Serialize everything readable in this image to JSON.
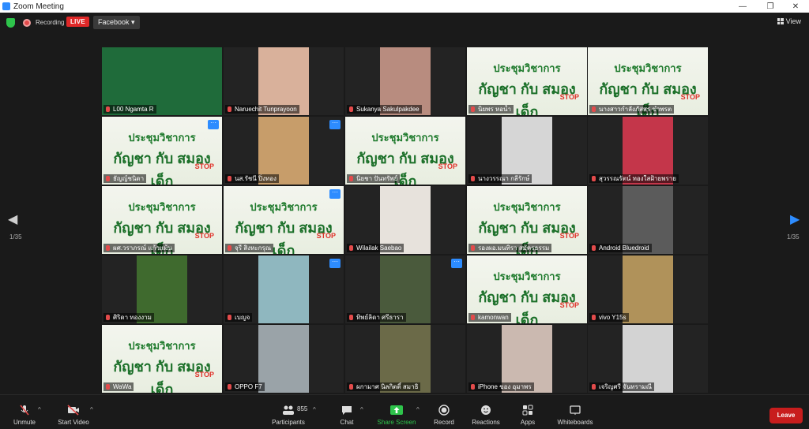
{
  "window": {
    "title": "Zoom Meeting",
    "minimize": "—",
    "maximize": "❐",
    "close": "✕"
  },
  "topbar": {
    "recording_label": "Recording",
    "live_badge": "LIVE",
    "stream_target": "Facebook ▾",
    "view_label": "View"
  },
  "pagination": {
    "left_page": "1/35",
    "right_page": "1/35"
  },
  "poster": {
    "title": "ประชุมวิชาการ",
    "subtitle": "กัญชา กับ สมองเด็ก",
    "stop": "STOP"
  },
  "tiles": [
    {
      "name": "L00 Ngamta R",
      "type": "video",
      "color": "#1f6b3a",
      "active": true
    },
    {
      "name": "Naruechit Tunprayoon",
      "type": "photo",
      "color": "#d9b19b"
    },
    {
      "name": "Sukanya Sakulpakdee",
      "type": "photo",
      "color": "#b88c7f"
    },
    {
      "name": "นิยพร หอน้ำ",
      "type": "poster"
    },
    {
      "name": "นางสาวกำลังภัสสร ขำพรต",
      "type": "poster"
    },
    {
      "name": "ธัญญ์ชนิดา",
      "type": "poster",
      "more": true
    },
    {
      "name": "นส.รัชนี ปิ่งทอง",
      "type": "photo",
      "color": "#c79d6a",
      "more": true
    },
    {
      "name": "นิยชา ปันทรัพย์",
      "type": "poster"
    },
    {
      "name": "นางวรรณา กลีรักษ์",
      "type": "photo",
      "color": "#d6d6d6"
    },
    {
      "name": "สุวรรณรัตน์ ทองใสฝ้ายพราย",
      "type": "photo",
      "color": "#c4364a"
    },
    {
      "name": "ผศ.วราภรณ์ แก้วแม้น",
      "type": "poster"
    },
    {
      "name": "จุรี สิงหะกรุณ",
      "type": "poster",
      "more": true
    },
    {
      "name": "Wilailak Saebao",
      "type": "photo",
      "color": "#e7e2dc"
    },
    {
      "name": "รองผอ.มนทิรา สมัครธรรม",
      "type": "poster"
    },
    {
      "name": "Android Bluedroid",
      "type": "photo",
      "color": "#5b5b5b"
    },
    {
      "name": "ศิริดา ทองงาม",
      "type": "photo",
      "color": "#3f6a2e"
    },
    {
      "name": "เบญจ",
      "type": "photo",
      "color": "#8fb7bf",
      "more": true
    },
    {
      "name": "ทิพย์ลิดา ศรีธารา",
      "type": "photo",
      "color": "#4a5a3c",
      "more": true
    },
    {
      "name": "kamonwan",
      "type": "poster"
    },
    {
      "name": "vivo Y15s",
      "type": "photo",
      "color": "#b0925a"
    },
    {
      "name": "WaWa",
      "type": "poster"
    },
    {
      "name": "OPPO F7",
      "type": "photo",
      "color": "#9aa3a8"
    },
    {
      "name": "ผกามาศ นิลกิตติ์ สมาธิ",
      "type": "photo",
      "color": "#6b6a48"
    },
    {
      "name": "iPhone ของ อุมาพร",
      "type": "photo",
      "color": "#cbb9b0"
    },
    {
      "name": "เจริญศรี จันทรามณี",
      "type": "photo",
      "color": "#d3d3d3"
    }
  ],
  "controls": {
    "unmute": "Unmute",
    "start_video": "Start Video",
    "participants": "Participants",
    "participants_count": "855",
    "chat": "Chat",
    "share_screen": "Share Screen",
    "record": "Record",
    "reactions": "Reactions",
    "apps": "Apps",
    "whiteboards": "Whiteboards",
    "leave": "Leave"
  },
  "colors": {
    "accent_blue": "#2d8cff",
    "share_green": "#2ec44b",
    "live_red": "#e02828",
    "leave_red": "#c81d1d",
    "active_speaker": "#d6e23c"
  }
}
